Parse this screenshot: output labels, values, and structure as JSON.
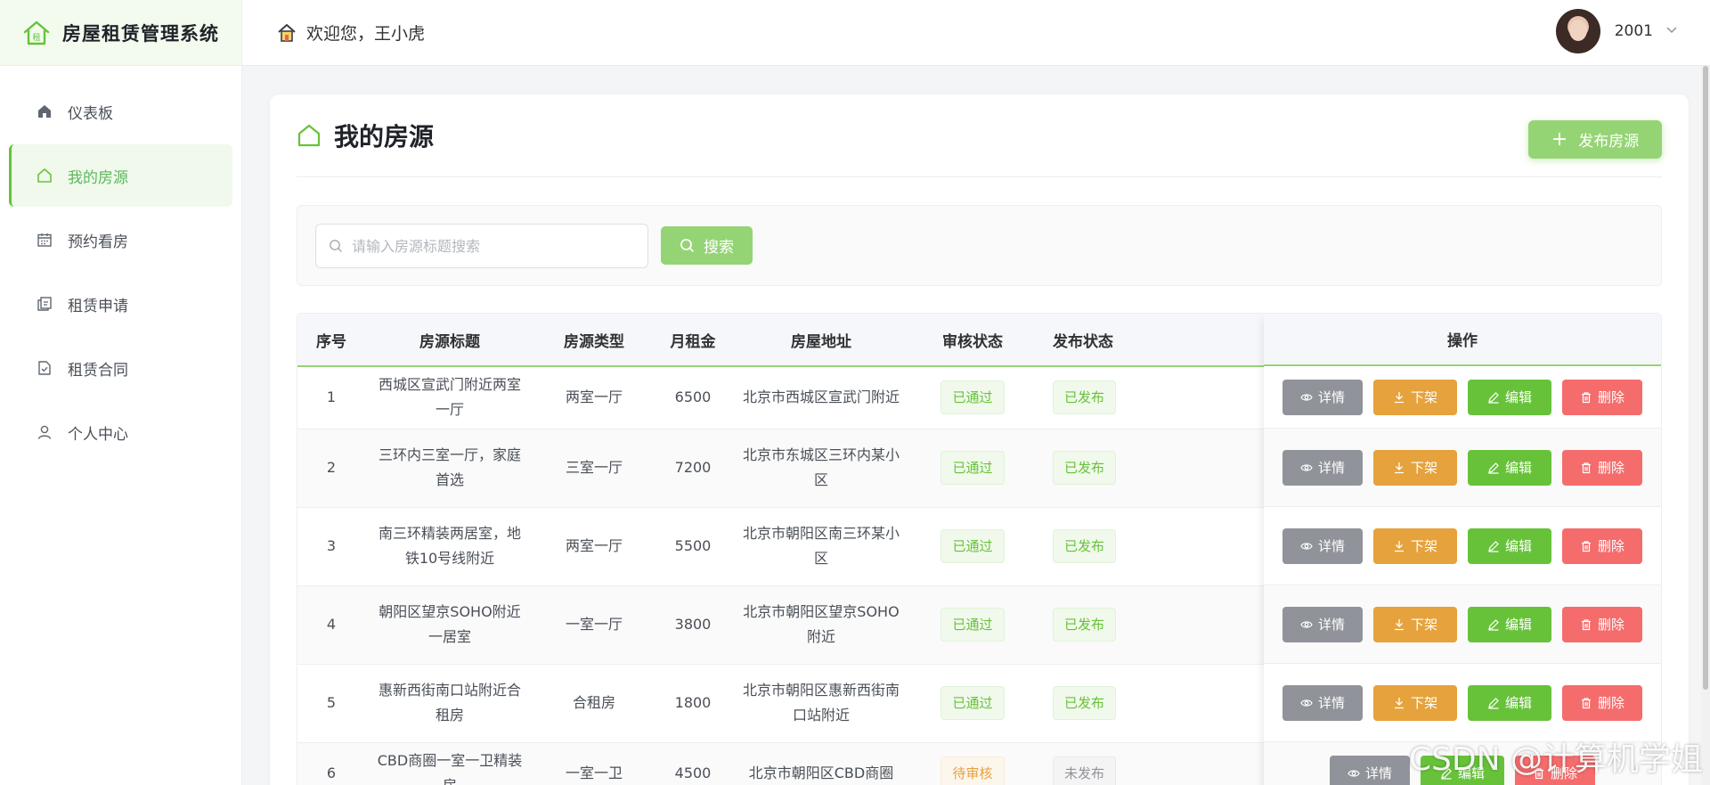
{
  "app": {
    "title": "房屋租赁管理系统",
    "logo_text": "租"
  },
  "sidebar": {
    "items": [
      {
        "label": "仪表板",
        "icon": "home-filled-icon",
        "active": false
      },
      {
        "label": "我的房源",
        "icon": "house-outline-icon",
        "active": true
      },
      {
        "label": "预约看房",
        "icon": "calendar-icon",
        "active": false
      },
      {
        "label": "租赁申请",
        "icon": "copy-document-icon",
        "active": false
      },
      {
        "label": "租赁合同",
        "icon": "document-checked-icon",
        "active": false
      },
      {
        "label": "个人中心",
        "icon": "user-icon",
        "active": false
      }
    ]
  },
  "header": {
    "welcome": "欢迎您，王小虎",
    "username": "2001"
  },
  "page": {
    "title": "我的房源",
    "publish_label": "发布房源",
    "search_placeholder": "请输入房源标题搜索",
    "search_label": "搜索"
  },
  "table": {
    "columns": [
      "序号",
      "房源标题",
      "房源类型",
      "月租金",
      "房屋地址",
      "审核状态",
      "发布状态",
      "操作"
    ],
    "action_labels": {
      "detail": "详情",
      "offline": "下架",
      "edit": "编辑",
      "delete": "删除"
    },
    "rows": [
      {
        "no": "1",
        "title": "西城区宣武门附近两室一厅",
        "type": "两室一厅",
        "rent": "6500",
        "address": "北京市西城区宣武门附近",
        "review": "已通过",
        "publish": "已发布"
      },
      {
        "no": "2",
        "title": "三环内三室一厅，家庭首选",
        "type": "三室一厅",
        "rent": "7200",
        "address": "北京市东城区三环内某小区",
        "review": "已通过",
        "publish": "已发布"
      },
      {
        "no": "3",
        "title": "南三环精装两居室，地铁10号线附近",
        "type": "两室一厅",
        "rent": "5500",
        "address": "北京市朝阳区南三环某小区",
        "review": "已通过",
        "publish": "已发布"
      },
      {
        "no": "4",
        "title": "朝阳区望京SOHO附近一居室",
        "type": "一室一厅",
        "rent": "3800",
        "address": "北京市朝阳区望京SOHO附近",
        "review": "已通过",
        "publish": "已发布"
      },
      {
        "no": "5",
        "title": "惠新西街南口站附近合租房",
        "type": "合租房",
        "rent": "1800",
        "address": "北京市朝阳区惠新西街南口站附近",
        "review": "已通过",
        "publish": "已发布"
      },
      {
        "no": "6",
        "title": "CBD商圈一室一卫精装房",
        "type": "一室一卫",
        "rent": "4500",
        "address": "北京市朝阳区CBD商圈",
        "review": "待审核",
        "publish": "未发布"
      }
    ]
  },
  "watermark": "CSDN @计算机学姐",
  "colors": {
    "primary": "#67c23a",
    "primary_light": "#95d475",
    "warning": "#e6a23c",
    "danger": "#f56c6c",
    "info": "#909399"
  }
}
